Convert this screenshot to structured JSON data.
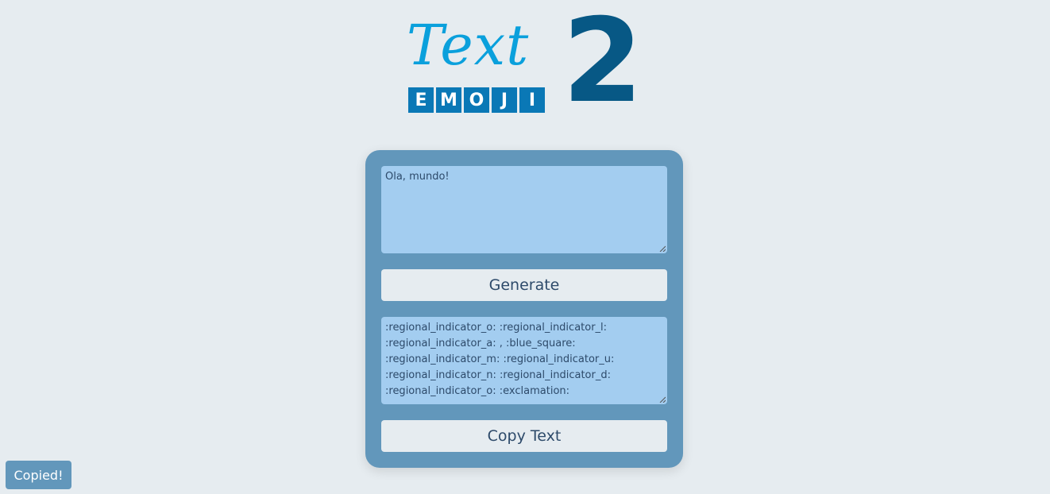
{
  "logo": {
    "word": "Text",
    "number": "2",
    "tiles": [
      "E",
      "M",
      "O",
      "J",
      "I"
    ]
  },
  "input": {
    "value": "Ola, mundo!"
  },
  "generate_button": {
    "label": "Generate"
  },
  "output": {
    "value": " :regional_indicator_o:  :regional_indicator_l:  :regional_indicator_a: , :blue_square:  :regional_indicator_m:  :regional_indicator_u:  :regional_indicator_n:  :regional_indicator_d:  :regional_indicator_o:  :exclamation:"
  },
  "copy_button": {
    "label": "Copy Text"
  },
  "toast": {
    "label": "Copied!"
  },
  "colors": {
    "background": "#e6ecf0",
    "card": "#6297bb",
    "textarea": "#a3cdf0",
    "logo_text": "#0aa0dc",
    "logo_number": "#075885",
    "logo_tile": "#0a78b6",
    "text": "#2d4a6a"
  }
}
